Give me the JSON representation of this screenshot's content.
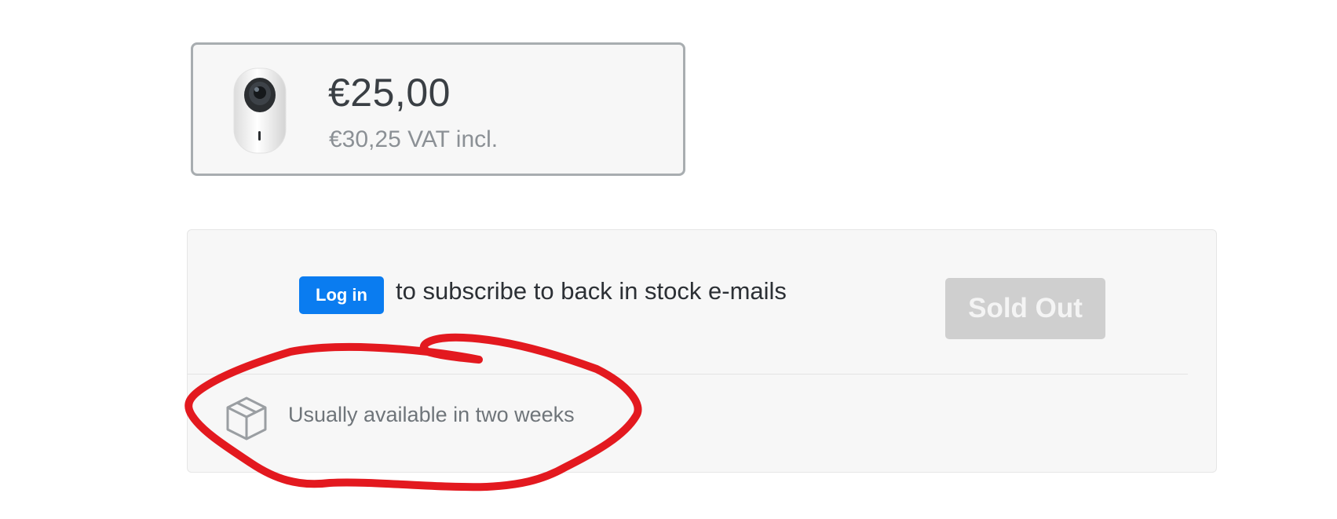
{
  "product": {
    "image_icon": "camera-icon",
    "price": "€25,00",
    "price_vat": "€30,25 VAT incl."
  },
  "stock": {
    "login_label": "Log in",
    "subscribe_text": "to subscribe to back in stock e-mails",
    "sold_out_label": "Sold Out",
    "availability_icon": "package-box-icon",
    "availability_text": "Usually available in two weeks"
  },
  "colors": {
    "login_button": "#0a7cf0",
    "sold_out_button": "#cfcfcf",
    "annotation_stroke": "#e3191f"
  }
}
